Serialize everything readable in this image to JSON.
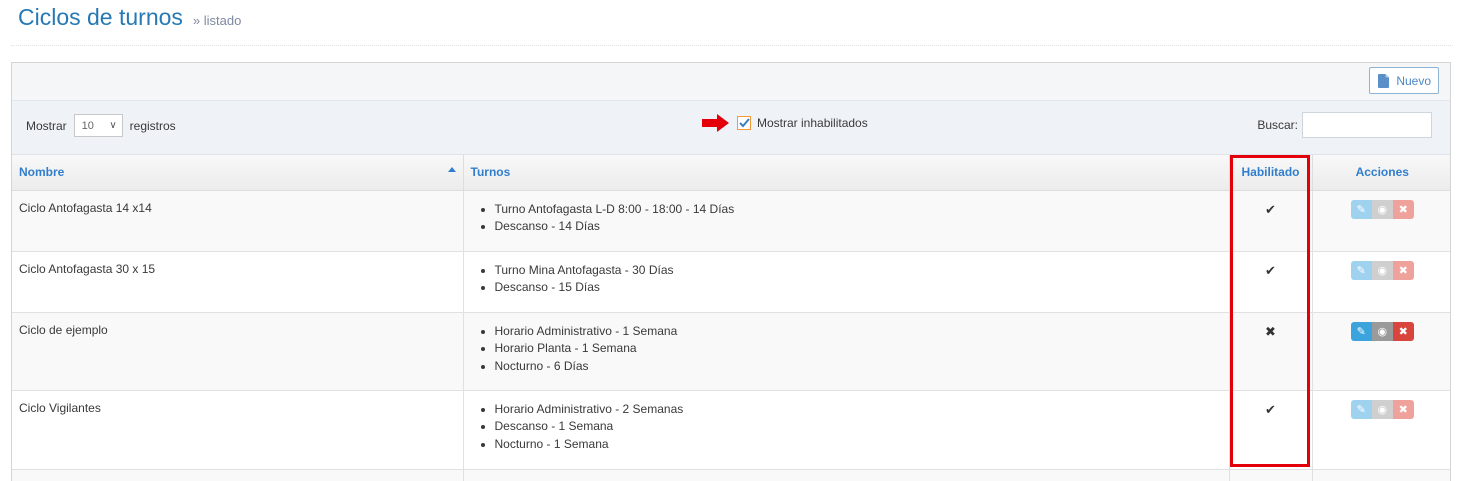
{
  "header": {
    "title": "Ciclos de turnos",
    "subtitle": "» listado"
  },
  "toolbar": {
    "new_label": "Nuevo"
  },
  "filters": {
    "show_label": "Mostrar",
    "show_value": "10",
    "records_label": "registros",
    "show_disabled_label": "Mostrar inhabilitados",
    "search_label": "Buscar:",
    "search_value": ""
  },
  "table": {
    "columns": [
      "Nombre",
      "Turnos",
      "Habilitado",
      "Acciones"
    ],
    "rows": [
      {
        "name": "Ciclo Antofagasta 14 x14",
        "turnos": [
          "Turno Antofagasta L-D 8:00 - 18:00 - 14 Días",
          "Descanso - 14 Días"
        ],
        "enabled_mark": "✔",
        "enabled": true
      },
      {
        "name": "Ciclo Antofagasta 30 x 15",
        "turnos": [
          "Turno Mina Antofagasta - 30 Días",
          "Descanso - 15 Días"
        ],
        "enabled_mark": "✔",
        "enabled": true
      },
      {
        "name": "Ciclo de ejemplo",
        "turnos": [
          "Horario Administrativo - 1 Semana",
          "Horario Planta - 1 Semana",
          "Nocturno - 6 Días"
        ],
        "enabled_mark": "✖",
        "enabled": false
      },
      {
        "name": "Ciclo Vigilantes",
        "turnos": [
          "Horario Administrativo - 2 Semanas",
          "Descanso - 1 Semana",
          "Nocturno - 1 Semana"
        ],
        "enabled_mark": "✔",
        "enabled": true
      }
    ]
  },
  "icons": {
    "edit": "pencil-square-icon",
    "view": "eye-icon",
    "delete": "trash-icon",
    "new": "document-icon"
  },
  "colors": {
    "accent": "#307ecc",
    "highlight": "#e3000b",
    "arrow": "#e3000b"
  }
}
